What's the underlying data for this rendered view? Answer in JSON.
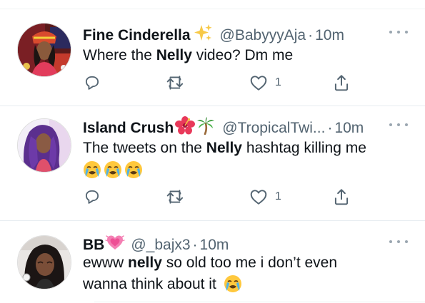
{
  "tweets": [
    {
      "display_name": "Fine Cinderella",
      "name_emoji": "sparkles",
      "handle": "@BabyyyAja",
      "separator": "·",
      "time": "10m",
      "text_parts": [
        "Where the ",
        "Nelly",
        " video? Dm me"
      ],
      "actions": {
        "reply_count": "",
        "retweet_count": "",
        "like_count": "1"
      },
      "icons": [
        "reply-icon",
        "retweet-icon",
        "like-icon",
        "share-icon",
        "more-icon"
      ]
    },
    {
      "display_name": "Island Crush",
      "name_emoji": "hibiscus palm-tree",
      "handle": "@TropicalTwi...",
      "separator": "·",
      "time": "10m",
      "text_parts": [
        "The tweets on the ",
        "Nelly",
        " hashtag killing me"
      ],
      "trailing_emoji": "crying-face x3",
      "actions": {
        "reply_count": "",
        "retweet_count": "",
        "like_count": "1"
      },
      "icons": [
        "reply-icon",
        "retweet-icon",
        "like-icon",
        "share-icon",
        "more-icon"
      ]
    },
    {
      "display_name": "BB",
      "name_emoji": "growing-heart",
      "handle": "@_bajx3",
      "separator": "·",
      "time": "10m",
      "text_parts": [
        "ewww ",
        "nelly",
        " so old too me i don’t even wanna think about it"
      ],
      "trailing_emoji": "crying-face",
      "icons": [
        "more-icon"
      ]
    }
  ],
  "colors": {
    "text": "#0f1419",
    "secondary": "#536471",
    "divider": "#e6ecf0",
    "emoji_face": "#ffc83d",
    "emoji_tear": "#4fb3e8"
  }
}
